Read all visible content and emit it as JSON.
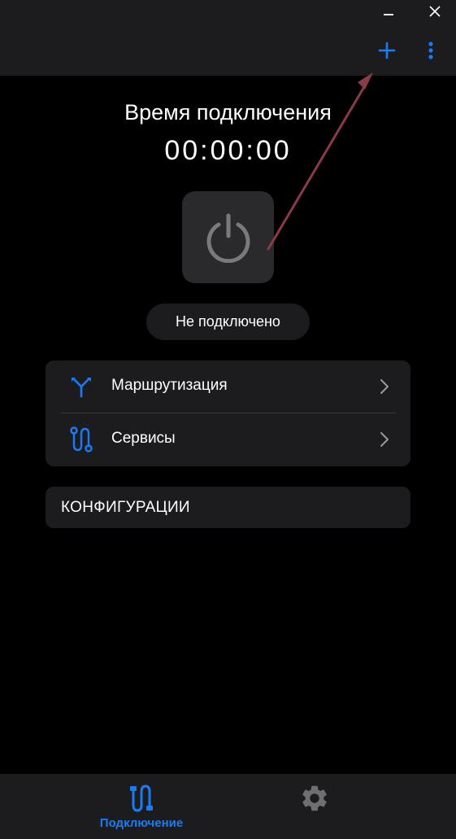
{
  "colors": {
    "accent": "#1a7cf5",
    "background": "#000000",
    "surface": "#1c1c1e",
    "power_button": "#2a2a2c",
    "power_icon": "#7a7a7a",
    "annotation_arrow": "#8b3a48"
  },
  "titlebar": {
    "minimize_icon": "minimize-icon",
    "close_icon": "close-icon",
    "add_icon": "plus-icon",
    "more_icon": "more-vertical-icon"
  },
  "connection": {
    "title": "Время подключения",
    "timer": "00:00:00",
    "power_icon": "power-icon",
    "status": "Не подключено"
  },
  "menu": {
    "items": [
      {
        "label": "Маршрутизация",
        "icon": "routing-split-icon"
      },
      {
        "label": "Сервисы",
        "icon": "services-path-icon"
      }
    ]
  },
  "configurations": {
    "label": "КОНФИГУРАЦИИ"
  },
  "bottom_nav": {
    "tabs": [
      {
        "label": "Подключение",
        "icon": "connection-icon",
        "active": true
      },
      {
        "label": "",
        "icon": "gear-icon",
        "active": false
      }
    ]
  }
}
